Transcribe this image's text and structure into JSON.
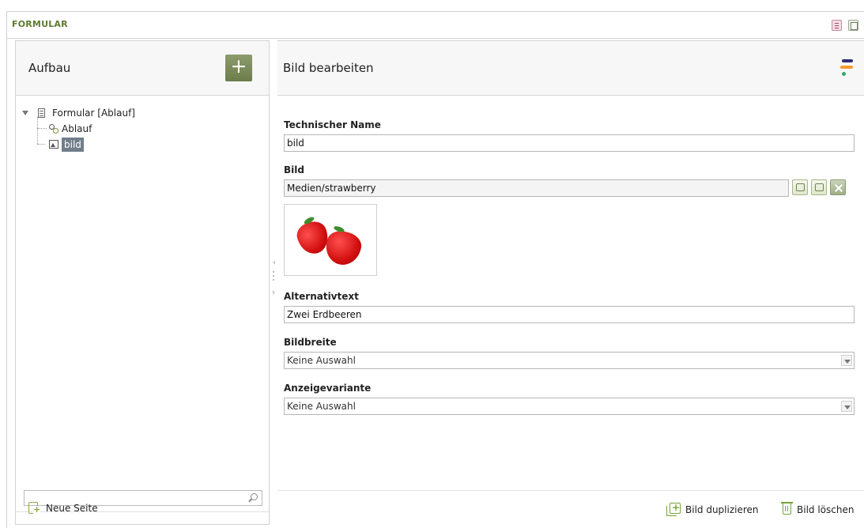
{
  "header": {
    "title": "FORMULAR",
    "icons": [
      "page-view-icon",
      "window-icon"
    ]
  },
  "left_panel": {
    "title": "Aufbau",
    "add_button_label": "+",
    "tree": [
      {
        "label": "Formular [Ablauf]",
        "icon": "form-document-icon",
        "expanded": true
      },
      {
        "label": "Ablauf",
        "icon": "workflow-gears-icon"
      },
      {
        "label": "bild",
        "icon": "image-icon",
        "selected": true
      }
    ],
    "search_placeholder": "",
    "new_page_label": "Neue Seite"
  },
  "right_panel": {
    "title": "Bild bearbeiten",
    "fields": {
      "technischer_name": {
        "label": "Technischer Name",
        "value": "bild"
      },
      "bild": {
        "label": "Bild",
        "value": "Medien/strawberry"
      },
      "alternativtext": {
        "label": "Alternativtext",
        "value": "Zwei Erdbeeren"
      },
      "bildbreite": {
        "label": "Bildbreite",
        "value": "Keine Auswahl"
      },
      "anzeigevariante": {
        "label": "Anzeigevariante",
        "value": "Keine Auswahl"
      }
    },
    "footer": {
      "duplicate_label": "Bild duplizieren",
      "delete_label": "Bild löschen"
    }
  },
  "colors": {
    "accent_green": "#6c7d4b",
    "selection": "#717d8a",
    "header_title": "#5f7a32"
  }
}
